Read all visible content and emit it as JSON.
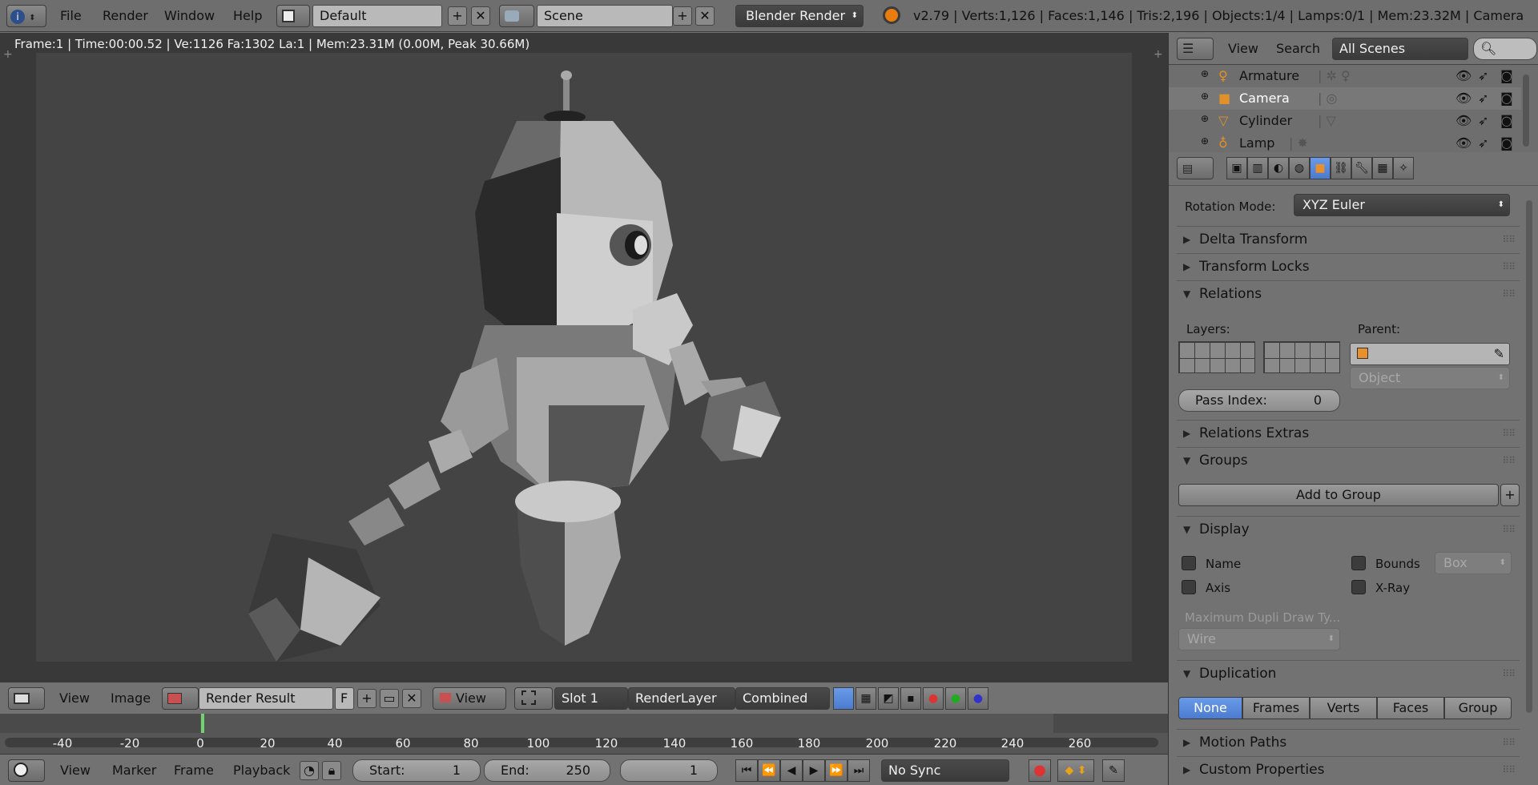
{
  "topbar": {
    "menus": [
      "File",
      "Render",
      "Window",
      "Help"
    ],
    "screen_layout": "Default",
    "scene": "Scene",
    "engine": "Blender Render",
    "stats": "v2.79 | Verts:1,126 | Faces:1,146 | Tris:2,196 | Objects:1/4 | Lamps:0/1 | Mem:23.32M | Camera"
  },
  "viewport": {
    "info": "Frame:1 | Time:00:00.52 | Ve:1126 Fa:1302 La:1 | Mem:23.31M (0.00M, Peak 30.66M)"
  },
  "image_header": {
    "view": "View",
    "image": "Image",
    "image_name": "Render Result",
    "fake_user": "F",
    "view_select": "View",
    "slot": "Slot 1",
    "render_layer": "RenderLayer",
    "pass": "Combined"
  },
  "timeline": {
    "ticks": [
      "-40",
      "-20",
      "0",
      "20",
      "40",
      "60",
      "80",
      "100",
      "120",
      "140",
      "160",
      "180",
      "200",
      "220",
      "240",
      "260"
    ],
    "menus": [
      "View",
      "Marker",
      "Frame",
      "Playback"
    ],
    "start_label": "Start:",
    "start_value": "1",
    "end_label": "End:",
    "end_value": "250",
    "current": "1",
    "sync": "No Sync"
  },
  "outliner": {
    "view": "View",
    "search": "Search",
    "scenes": "All Scenes",
    "items": [
      {
        "name": "Armature",
        "icon": "armature-icon"
      },
      {
        "name": "Camera",
        "icon": "camera-icon"
      },
      {
        "name": "Cylinder",
        "icon": "mesh-icon"
      },
      {
        "name": "Lamp",
        "icon": "lamp-icon"
      }
    ]
  },
  "properties": {
    "rotation_mode_label": "Rotation Mode:",
    "rotation_mode": "XYZ Euler",
    "panels": {
      "delta": "Delta Transform",
      "locks": "Transform Locks",
      "relations": "Relations",
      "relations_extras": "Relations Extras",
      "groups": "Groups",
      "display": "Display",
      "duplication": "Duplication",
      "motion_paths": "Motion Paths",
      "custom_props": "Custom Properties"
    },
    "layers_label": "Layers:",
    "parent_label": "Parent:",
    "parent_type": "Object",
    "pass_index_label": "Pass Index:",
    "pass_index": "0",
    "add_to_group": "Add to Group",
    "display": {
      "name": "Name",
      "axis": "Axis",
      "bounds": "Bounds",
      "bounds_type": "Box",
      "xray": "X-Ray",
      "max_dupli_label": "Maximum Dupli Draw Ty...",
      "max_dupli": "Wire"
    },
    "duplication": [
      "None",
      "Frames",
      "Verts",
      "Faces",
      "Group"
    ],
    "duplication_selected": "None"
  }
}
